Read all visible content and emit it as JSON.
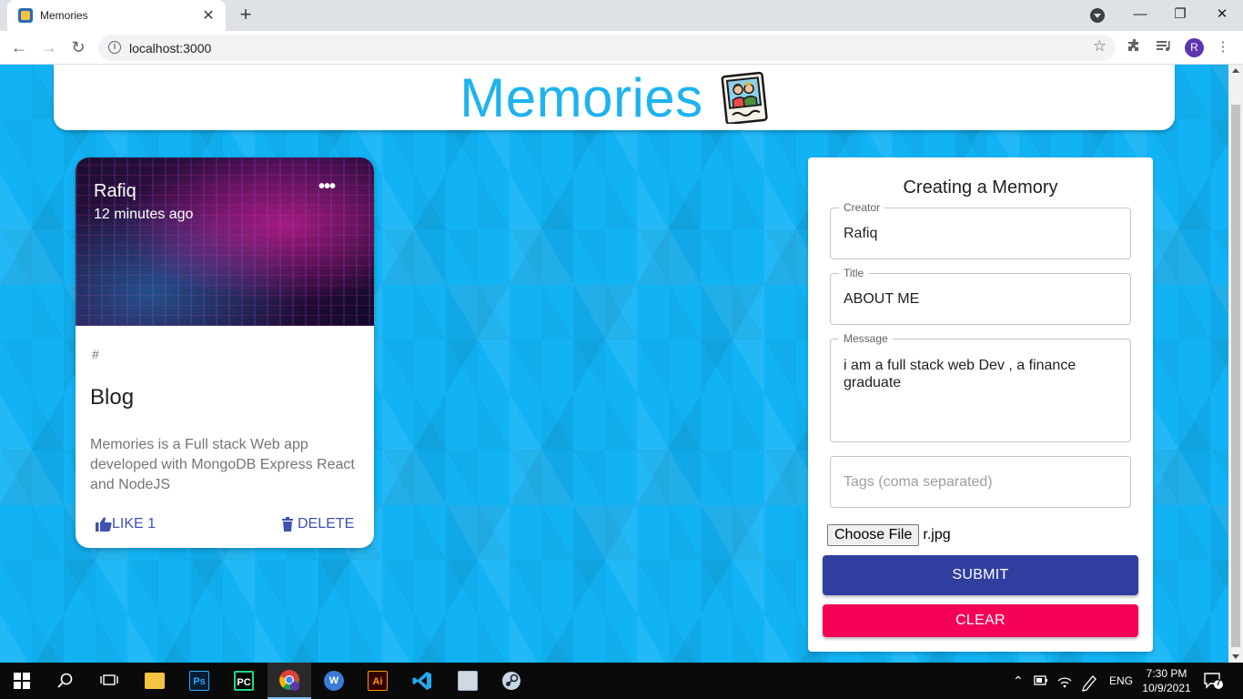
{
  "browser": {
    "tab_title": "Memories",
    "tab_close": "✕",
    "new_tab": "+",
    "url": "localhost:3000",
    "profile_initial": "R",
    "window_minimize": "—",
    "window_restore": "❐",
    "window_close": "✕"
  },
  "app": {
    "heading": "Memories"
  },
  "post": {
    "creator": "Rafiq",
    "time_ago": "12 minutes ago",
    "more_glyph": "•••",
    "tags": "#",
    "title": "Blog",
    "message": "Memories is a Full stack Web app developed with MongoDB Express React and NodeJS",
    "like_label": "LIKE 1",
    "delete_label": "DELETE"
  },
  "form": {
    "title": "Creating a Memory",
    "creator_label": "Creator",
    "creator_value": "Rafiq",
    "title_label": "Title",
    "title_value": "ABOUT ME",
    "message_label": "Message",
    "message_value": "i am a full stack web Dev , a finance graduate",
    "tags_placeholder": "Tags (coma separated)",
    "file_button": "Choose File",
    "file_name": "r.jpg",
    "submit_label": "SUBMIT",
    "clear_label": "CLEAR"
  },
  "taskbar": {
    "apps": [
      {
        "name": "File Explorer",
        "glyph": "",
        "color": "#f6c343"
      },
      {
        "name": "Photoshop",
        "glyph": "Ps",
        "color": "#31a8ff"
      },
      {
        "name": "PyCharm",
        "glyph": "PC",
        "color": "#21d789"
      },
      {
        "name": "Chrome",
        "glyph": "",
        "color": "#4285f4"
      },
      {
        "name": "WebStorm",
        "glyph": "W",
        "color": "#3a7bd5"
      },
      {
        "name": "Illustrator",
        "glyph": "Ai",
        "color": "#ff9a00"
      },
      {
        "name": "VS Code",
        "glyph": "",
        "color": "#23a9f2"
      },
      {
        "name": "Monitor",
        "glyph": "",
        "color": "#9bb7d4"
      },
      {
        "name": "Steam",
        "glyph": "",
        "color": "#1b2838"
      }
    ],
    "language": "ENG",
    "time": "7:30 PM",
    "date": "10/9/2021",
    "notification_count": "7"
  },
  "colors": {
    "primary": "#3f51b5",
    "submit": "#303f9f",
    "clear": "#f50057",
    "heading": "#1eb3f0",
    "background": "#12b3f5"
  }
}
